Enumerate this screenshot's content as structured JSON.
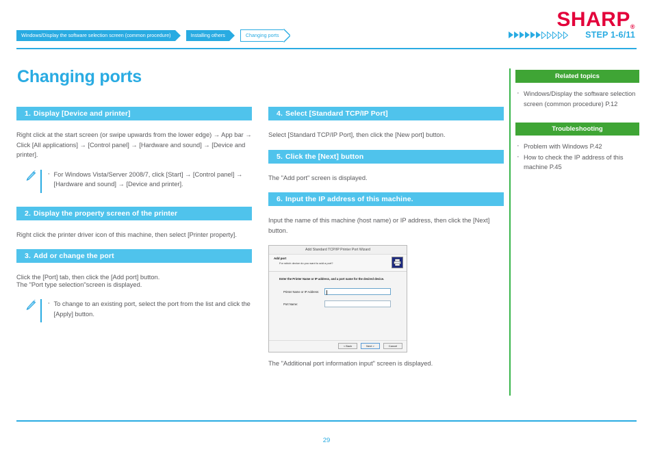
{
  "brand": {
    "logo_text": "SHARP",
    "registered_mark": "®",
    "logo_color": "#e3003a"
  },
  "header": {
    "breadcrumb": [
      {
        "label": "Windows/Display the software selection screen (common procedure)",
        "state": "filled"
      },
      {
        "label": "Installing others",
        "state": "filled"
      },
      {
        "label": "Changing ports",
        "state": "outlined"
      }
    ],
    "step_indicator": {
      "label": "STEP  1-6/11",
      "total": 11,
      "filled": 6,
      "color": "#29ABE2"
    }
  },
  "page": {
    "title": "Changing ports",
    "title_color": "#29ABE2",
    "page_number": "29"
  },
  "steps": [
    {
      "number": "1.",
      "heading": "Display [Device and printer]",
      "paragraphs": [
        "Right click at the start screen (or swipe upwards from the lower edge) → App bar → Click [All applications] → [Control panel] → [Hardware and sound] → [Device and printer]."
      ],
      "note": {
        "icon": "pencil-icon",
        "items": [
          "For Windows Vista/Server 2008/7, click [Start] → [Control panel] → [Hardware and sound] → [Device and printer]."
        ]
      }
    },
    {
      "number": "2.",
      "heading": "Display the property screen of the printer",
      "paragraphs": [
        "Right click the printer driver icon of this machine, then select [Printer property]."
      ]
    },
    {
      "number": "3.",
      "heading": "Add or change the port",
      "paragraphs": [
        "Click the [Port] tab, then click the [Add port] button.",
        "The \"Port type selection\"screen is displayed."
      ],
      "note": {
        "icon": "pencil-icon",
        "items": [
          "To change to an existing port, select the port from the list and click the [Apply] button."
        ]
      }
    },
    {
      "number": "4.",
      "heading": "Select [Standard TCP/IP Port]",
      "paragraphs": [
        "Select [Standard TCP/IP Port], then click the [New port] button."
      ]
    },
    {
      "number": "5.",
      "heading": "Click the [Next] button",
      "paragraphs": [
        "The \"Add port\" screen is displayed."
      ]
    },
    {
      "number": "6.",
      "heading": "Input the IP address of this machine.",
      "paragraphs": [
        "Input the name of this machine (host name) or IP address, then click the [Next] button."
      ],
      "caption": "The \"Additional port information input\" screen is displayed."
    }
  ],
  "wizard_dialog": {
    "title": "Add Standard TCP/IP Printer Port Wizard",
    "banner_title": "Add port",
    "banner_subtitle": "For which device do you want to add a port?",
    "icon": "printer-icon",
    "prompt": "Enter the Printer Name or IP address, and a port name for the desired device.",
    "fields": [
      {
        "label": "Printer Name or IP Address:",
        "value": "",
        "focused": true
      },
      {
        "label": "Port Name:",
        "value": "",
        "focused": false
      }
    ],
    "buttons": [
      {
        "label": "< Back",
        "primary": false
      },
      {
        "label": "Next >",
        "primary": true
      },
      {
        "label": "Cancel",
        "primary": false
      }
    ]
  },
  "sidebar": {
    "sections": [
      {
        "heading": "Related topics",
        "color": "#3FA535",
        "items": [
          "Windows/Display the software selection screen (common procedure) P.12"
        ]
      },
      {
        "heading": "Troubleshooting",
        "color": "#3FA535",
        "items": [
          "Problem with Windows P.42",
          "How to check the IP address of this machine P.45"
        ]
      }
    ]
  }
}
